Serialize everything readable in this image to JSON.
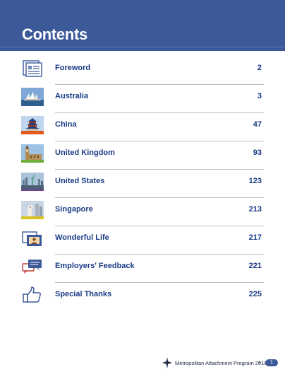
{
  "page": {
    "title": "Contents",
    "colors": {
      "brand": "#3c5a99",
      "text": "#1a3b86"
    }
  },
  "toc": [
    {
      "label": "Foreword",
      "page": "2",
      "icon": "document-list-icon"
    },
    {
      "label": "Australia",
      "page": "3",
      "icon": "sydney-opera-house-photo"
    },
    {
      "label": "China",
      "page": "47",
      "icon": "temple-of-heaven-photo"
    },
    {
      "label": "United Kingdom",
      "page": "93",
      "icon": "big-ben-photo"
    },
    {
      "label": "United States",
      "page": "123",
      "icon": "statue-of-liberty-photo"
    },
    {
      "label": "Singapore",
      "page": "213",
      "icon": "merlion-photo"
    },
    {
      "label": "Wonderful Life",
      "page": "217",
      "icon": "photo-frames-icon"
    },
    {
      "label": "Employers' Feedback",
      "page": "221",
      "icon": "speech-bubbles-icon"
    },
    {
      "label": "Special Thanks",
      "page": "225",
      "icon": "thumbs-up-icon"
    }
  ],
  "footer": {
    "program": "Metropolitan Attachment Program 2010",
    "bullet": "•",
    "page_number": "1"
  }
}
